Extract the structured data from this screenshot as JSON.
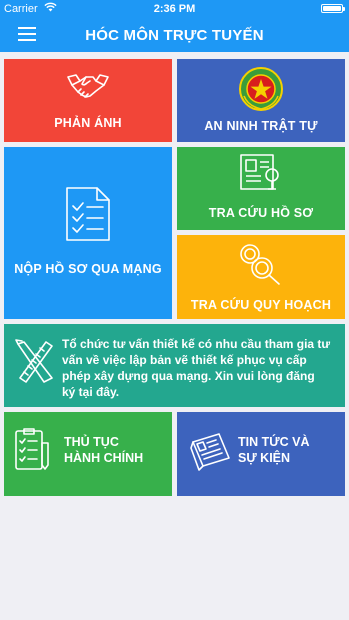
{
  "status_bar": {
    "carrier": "Carrier",
    "time": "2:36 PM"
  },
  "header": {
    "title": "HÓC MÔN TRỰC TUYẾN",
    "menu_icon": "hamburger-menu-icon"
  },
  "tiles": {
    "phan_anh": {
      "label": "PHẢN ÁNH",
      "icon": "handshake-icon",
      "color": "#f24538"
    },
    "an_ninh": {
      "label": "AN NINH TRẬT TỰ",
      "icon": "police-emblem-icon",
      "color": "#3d63bd"
    },
    "nop_ho_so": {
      "label": "NỘP HỒ SƠ QUA MẠNG",
      "icon": "document-checklist-icon",
      "color": "#1e98f5"
    },
    "tra_cuu_ho_so": {
      "label": "TRA CỨU HỒ SƠ",
      "icon": "profile-document-icon",
      "color": "#37b04b"
    },
    "tra_cuu_quy_hoach": {
      "label": "TRA CỨU QUY HOẠCH",
      "icon": "magnifier-search-icon",
      "color": "#fdb30b"
    },
    "tu_van_thiet_ke": {
      "text": "Tổ chức tư vấn thiết kế có nhu cầu tham gia tư vấn về việc lập bản vẽ thiết kế phục vụ cấp phép xây dựng qua mạng. Xin vui lòng đăng ký tại đây.",
      "icon": "pencil-ruler-icon",
      "color": "#23a78f"
    },
    "thu_tuc": {
      "line1": "THỦ TỤC",
      "line2": "HÀNH CHÍNH",
      "icon": "checklist-icon",
      "color": "#37b04b"
    },
    "tin_tuc": {
      "line1": "TIN TỨC VÀ",
      "line2": "SỰ KIỆN",
      "icon": "newspaper-icon",
      "color": "#3d63bd"
    }
  }
}
